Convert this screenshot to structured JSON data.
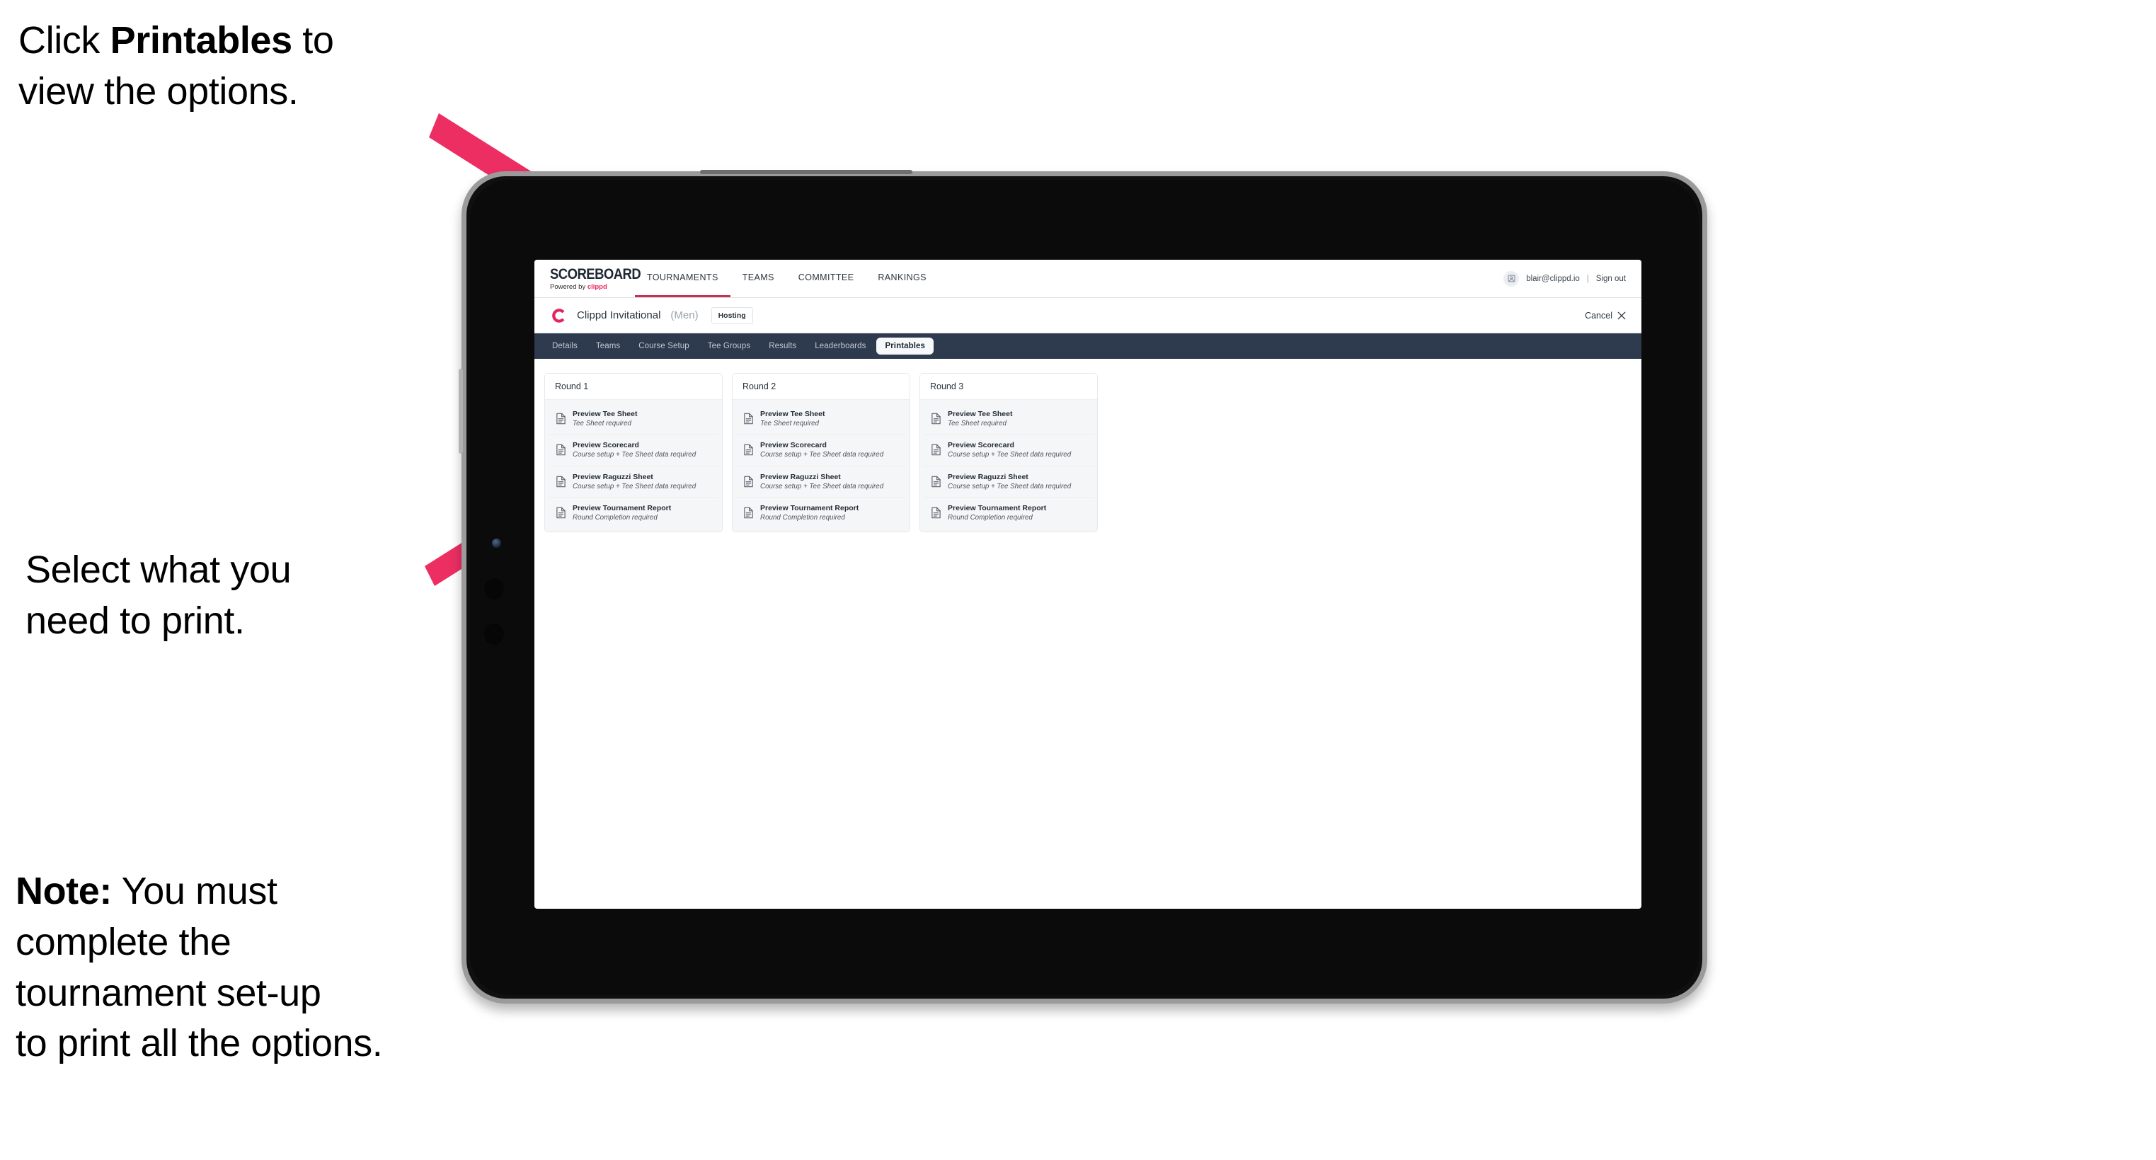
{
  "annotations": {
    "step1": {
      "prefix": "Click ",
      "bold": "Printables",
      "suffix": " to\nview the options."
    },
    "step2": {
      "text": "Select what you\n need to print."
    },
    "step3": {
      "bold": "Note:",
      "text": " You must\ncomplete the\ntournament set-up\nto print all the options."
    }
  },
  "colors": {
    "arrow": "#ED2E63",
    "accent": "#E3255C",
    "tabstrip": "#2E3A4E",
    "topnav_active_underline": "#C43253"
  },
  "app": {
    "brand": {
      "wordmark": "SCOREBOARD",
      "powered_by": "Powered by ",
      "powered_by_brand": "clippd"
    },
    "topnav": {
      "links": [
        {
          "label": "TOURNAMENTS",
          "active": true
        },
        {
          "label": "TEAMS",
          "active": false
        },
        {
          "label": "COMMITTEE",
          "active": false
        },
        {
          "label": "RANKINGS",
          "active": false
        }
      ],
      "avatar_icon": "user-avatar-icon",
      "user_email": "blair@clippd.io",
      "separator": "|",
      "sign_out": "Sign out"
    },
    "tournament_header": {
      "logo_letter": "C",
      "name": "Clippd Invitational",
      "gender": "(Men)",
      "status_badge": "Hosting",
      "cancel_label": "Cancel",
      "cancel_icon": "close-icon"
    },
    "tabs": [
      {
        "label": "Details",
        "active": false
      },
      {
        "label": "Teams",
        "active": false
      },
      {
        "label": "Course Setup",
        "active": false
      },
      {
        "label": "Tee Groups",
        "active": false
      },
      {
        "label": "Results",
        "active": false
      },
      {
        "label": "Leaderboards",
        "active": false
      },
      {
        "label": "Printables",
        "active": true
      }
    ],
    "rounds": [
      {
        "title": "Round 1",
        "items": [
          {
            "title": "Preview Tee Sheet",
            "sub": "Tee Sheet required"
          },
          {
            "title": "Preview Scorecard",
            "sub": "Course setup + Tee Sheet data required"
          },
          {
            "title": "Preview Raguzzi Sheet",
            "sub": "Course setup + Tee Sheet data required"
          },
          {
            "title": "Preview Tournament Report",
            "sub": "Round Completion required"
          }
        ]
      },
      {
        "title": "Round 2",
        "items": [
          {
            "title": "Preview Tee Sheet",
            "sub": "Tee Sheet required"
          },
          {
            "title": "Preview Scorecard",
            "sub": "Course setup + Tee Sheet data required"
          },
          {
            "title": "Preview Raguzzi Sheet",
            "sub": "Course setup + Tee Sheet data required"
          },
          {
            "title": "Preview Tournament Report",
            "sub": "Round Completion required"
          }
        ]
      },
      {
        "title": "Round 3",
        "items": [
          {
            "title": "Preview Tee Sheet",
            "sub": "Tee Sheet required"
          },
          {
            "title": "Preview Scorecard",
            "sub": "Course setup + Tee Sheet data required"
          },
          {
            "title": "Preview Raguzzi Sheet",
            "sub": "Course setup + Tee Sheet data required"
          },
          {
            "title": "Preview Tournament Report",
            "sub": "Round Completion required"
          }
        ]
      }
    ]
  }
}
